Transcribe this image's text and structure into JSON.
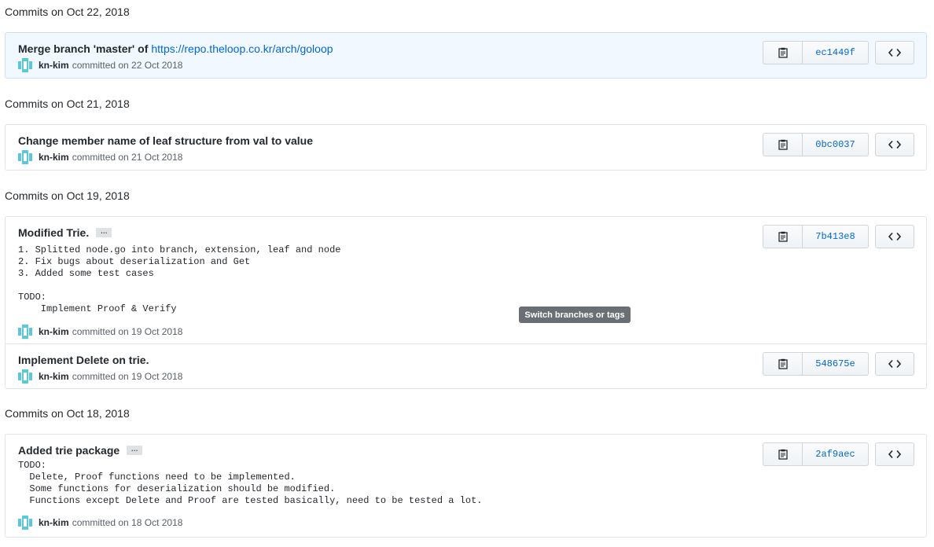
{
  "groups": [
    {
      "title": "Commits on Oct 22, 2018",
      "commits": [
        {
          "title": "Merge branch 'master' of",
          "link": "https://repo.theloop.co.kr/arch/goloop",
          "author": "kn-kim",
          "committed": "committed on 22 Oct 2018",
          "sha": "ec1449f"
        }
      ]
    },
    {
      "title": "Commits on Oct 21, 2018",
      "commits": [
        {
          "title": "Change member name of leaf structure from val to value",
          "author": "kn-kim",
          "committed": "committed on 21 Oct 2018",
          "sha": "0bc0037"
        }
      ]
    },
    {
      "title": "Commits on Oct 19, 2018",
      "commits": [
        {
          "title": "Modified Trie.",
          "ellipsis": "…",
          "description": "1. Splitted node.go into branch, extension, leaf and node\n2. Fix bugs about deserialization and Get\n3. Added some test cases\n\nTODO:\n    Implement Proof & Verify",
          "author": "kn-kim",
          "committed": "committed on 19 Oct 2018",
          "sha": "7b413e8"
        },
        {
          "title": "Implement Delete on trie.",
          "author": "kn-kim",
          "committed": "committed on 19 Oct 2018",
          "sha": "548675e"
        }
      ]
    },
    {
      "title": "Commits on Oct 18, 2018",
      "commits": [
        {
          "title": "Added trie package",
          "ellipsis": "…",
          "description": "TODO:\n  Delete, Proof functions need to be implemented.\n  Some functions for deserialization should be modified.\n  Functions except Delete and Proof are tested basically, need to be tested a lot.",
          "author": "kn-kim",
          "committed": "committed on 18 Oct 2018",
          "sha": "2af9aec"
        }
      ]
    }
  ],
  "tooltip": "Switch branches or tags",
  "icons": {
    "copy": "clipboard-icon",
    "browse": "code-icon",
    "avatar": "identicon-avatar"
  },
  "colors": {
    "link": "#0366d6",
    "highlight_bg": "#f1f8ff",
    "avatar": "#5ac8d8"
  }
}
